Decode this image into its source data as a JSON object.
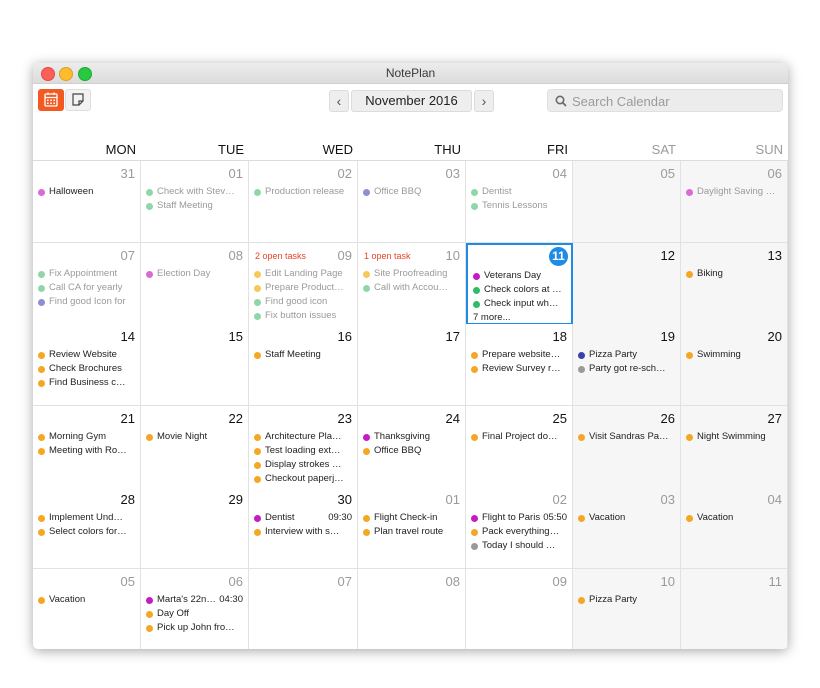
{
  "window": {
    "title": "NotePlan"
  },
  "toolbar": {
    "calendar_icon": "calendar-icon",
    "note_icon": "note-icon",
    "prev": "‹",
    "next": "›",
    "month": "November 2016",
    "search_placeholder": "Search Calendar"
  },
  "colors": {
    "accent": "#f25a22",
    "today": "#1e8be6",
    "open_tasks": "#e8442b"
  },
  "day_headers": [
    "MON",
    "TUE",
    "WED",
    "THU",
    "FRI",
    "SAT",
    "SUN"
  ],
  "weeks": [
    [
      {
        "day": "31",
        "state": "other",
        "events": [
          {
            "text": "Halloween",
            "color": "#d96ad6"
          }
        ]
      },
      {
        "day": "01",
        "state": "past",
        "events": [
          {
            "text": "Check with Stev…",
            "color": "#8fd7a8"
          },
          {
            "text": "Staff Meeting",
            "color": "#8fd7a8"
          }
        ]
      },
      {
        "day": "02",
        "state": "past",
        "events": [
          {
            "text": "Production release",
            "color": "#8fd7a8"
          }
        ]
      },
      {
        "day": "03",
        "state": "past",
        "events": [
          {
            "text": "Office BBQ",
            "color": "#8d8fd0"
          }
        ]
      },
      {
        "day": "04",
        "state": "past",
        "events": [
          {
            "text": "Dentist",
            "color": "#8fd7a8"
          },
          {
            "text": "Tennis Lessons",
            "color": "#8fd7a8"
          }
        ]
      },
      {
        "day": "05",
        "state": "past",
        "events": []
      },
      {
        "day": "06",
        "state": "past",
        "events": [
          {
            "text": "Daylight Saving …",
            "color": "#d96ad6"
          }
        ]
      }
    ],
    [
      {
        "day": "07",
        "state": "past",
        "events": [
          {
            "text": "Fix Appointment",
            "color": "#8fd7a8"
          },
          {
            "text": "Call CA for yearly",
            "color": "#8fd7a8"
          },
          {
            "text": "Find good Icon for",
            "color": "#8d8fd0"
          }
        ]
      },
      {
        "day": "08",
        "state": "past",
        "events": [
          {
            "text": "Election Day",
            "color": "#d96ad6"
          }
        ]
      },
      {
        "day": "09",
        "state": "past",
        "open": "2 open tasks",
        "events": [
          {
            "text": "Edit Landing Page",
            "color": "#f5c85a"
          },
          {
            "text": "Prepare Product…",
            "color": "#f5c85a"
          },
          {
            "text": "Find good icon",
            "color": "#8fd7a8"
          },
          {
            "text": "Fix button issues",
            "color": "#8fd7a8"
          }
        ]
      },
      {
        "day": "10",
        "state": "past",
        "open": "1 open task",
        "events": [
          {
            "text": "Site Proofreading",
            "color": "#f5c85a"
          },
          {
            "text": "Call with Accou…",
            "color": "#8fd7a8"
          }
        ]
      },
      {
        "day": "11",
        "state": "today",
        "events": [
          {
            "text": "Veterans Day",
            "color": "#c41bc4"
          },
          {
            "text": "Check colors at …",
            "color": "#2fbb6a"
          },
          {
            "text": "Check input wh…",
            "color": "#2fbb6a"
          }
        ],
        "more": "7 more..."
      },
      {
        "day": "12",
        "state": "current",
        "events": []
      },
      {
        "day": "13",
        "state": "current",
        "events": [
          {
            "text": "Biking",
            "color": "#f5a623"
          }
        ]
      }
    ],
    [
      {
        "day": "14",
        "state": "current",
        "events": [
          {
            "text": "Review Website",
            "color": "#f5a623"
          },
          {
            "text": "Check Brochures",
            "color": "#f5a623"
          },
          {
            "text": "Find Business c…",
            "color": "#f5a623"
          }
        ]
      },
      {
        "day": "15",
        "state": "current",
        "events": []
      },
      {
        "day": "16",
        "state": "current",
        "events": [
          {
            "text": "Staff Meeting",
            "color": "#f5a623"
          }
        ]
      },
      {
        "day": "17",
        "state": "current",
        "events": []
      },
      {
        "day": "18",
        "state": "current",
        "events": [
          {
            "text": "Prepare website…",
            "color": "#f5a623"
          },
          {
            "text": "Review Survey r…",
            "color": "#f5a623"
          }
        ]
      },
      {
        "day": "19",
        "state": "current",
        "events": [
          {
            "text": "Pizza Party",
            "color": "#3a3fae"
          },
          {
            "text": "Party got re-sch…",
            "color": "#9a9a9a"
          }
        ]
      },
      {
        "day": "20",
        "state": "current",
        "events": [
          {
            "text": "Swimming",
            "color": "#f5a623"
          }
        ]
      }
    ],
    [
      {
        "day": "21",
        "state": "current",
        "events": [
          {
            "text": "Morning Gym",
            "color": "#f5a623"
          },
          {
            "text": "Meeting with Ro…",
            "color": "#f5a623"
          }
        ]
      },
      {
        "day": "22",
        "state": "current",
        "events": [
          {
            "text": "Movie Night",
            "color": "#f5a623"
          }
        ]
      },
      {
        "day": "23",
        "state": "current",
        "events": [
          {
            "text": "Architecture Pla…",
            "color": "#f5a623"
          },
          {
            "text": "Test loading ext…",
            "color": "#f5a623"
          },
          {
            "text": "Display strokes …",
            "color": "#f5a623"
          },
          {
            "text": "Checkout paperj…",
            "color": "#f5a623"
          }
        ]
      },
      {
        "day": "24",
        "state": "current",
        "events": [
          {
            "text": "Thanksgiving",
            "color": "#c41bc4"
          },
          {
            "text": "Office BBQ",
            "color": "#f5a623"
          }
        ]
      },
      {
        "day": "25",
        "state": "current",
        "events": [
          {
            "text": "Final Project do…",
            "color": "#f5a623"
          }
        ]
      },
      {
        "day": "26",
        "state": "current",
        "events": [
          {
            "text": "Visit Sandras Pa…",
            "color": "#f5a623"
          }
        ]
      },
      {
        "day": "27",
        "state": "current",
        "events": [
          {
            "text": "Night Swimming",
            "color": "#f5a623"
          }
        ]
      }
    ],
    [
      {
        "day": "28",
        "state": "current",
        "events": [
          {
            "text": "Implement Und…",
            "color": "#f5a623"
          },
          {
            "text": "Select colors for…",
            "color": "#f5a623"
          }
        ]
      },
      {
        "day": "29",
        "state": "current",
        "events": []
      },
      {
        "day": "30",
        "state": "current",
        "events": [
          {
            "text": "Dentist",
            "color": "#c41bc4",
            "time": "09:30"
          },
          {
            "text": "Interview with s…",
            "color": "#f5a623"
          }
        ]
      },
      {
        "day": "01",
        "state": "other",
        "events": [
          {
            "text": "Flight Check-in",
            "color": "#f5a623"
          },
          {
            "text": "Plan travel route",
            "color": "#f5a623"
          }
        ]
      },
      {
        "day": "02",
        "state": "other",
        "events": [
          {
            "text": "Flight to Paris",
            "color": "#c41bc4",
            "time": "05:50"
          },
          {
            "text": "Pack everything…",
            "color": "#f5a623"
          },
          {
            "text": "Today I should …",
            "color": "#9a9a9a"
          }
        ]
      },
      {
        "day": "03",
        "state": "other",
        "events": [
          {
            "text": "Vacation",
            "color": "#f5a623"
          }
        ]
      },
      {
        "day": "04",
        "state": "other",
        "events": [
          {
            "text": "Vacation",
            "color": "#f5a623"
          }
        ]
      }
    ],
    [
      {
        "day": "05",
        "state": "other",
        "events": [
          {
            "text": "Vacation",
            "color": "#f5a623"
          }
        ]
      },
      {
        "day": "06",
        "state": "other",
        "events": [
          {
            "text": "Marta's 22n…",
            "color": "#c41bc4",
            "time": "04:30"
          },
          {
            "text": "Day Off",
            "color": "#f5a623"
          },
          {
            "text": "Pick up John fro…",
            "color": "#f5a623"
          }
        ]
      },
      {
        "day": "07",
        "state": "other",
        "events": []
      },
      {
        "day": "08",
        "state": "other",
        "events": []
      },
      {
        "day": "09",
        "state": "other",
        "events": []
      },
      {
        "day": "10",
        "state": "other",
        "events": [
          {
            "text": "Pizza Party",
            "color": "#f5a623"
          }
        ]
      },
      {
        "day": "11",
        "state": "other",
        "events": []
      }
    ]
  ]
}
